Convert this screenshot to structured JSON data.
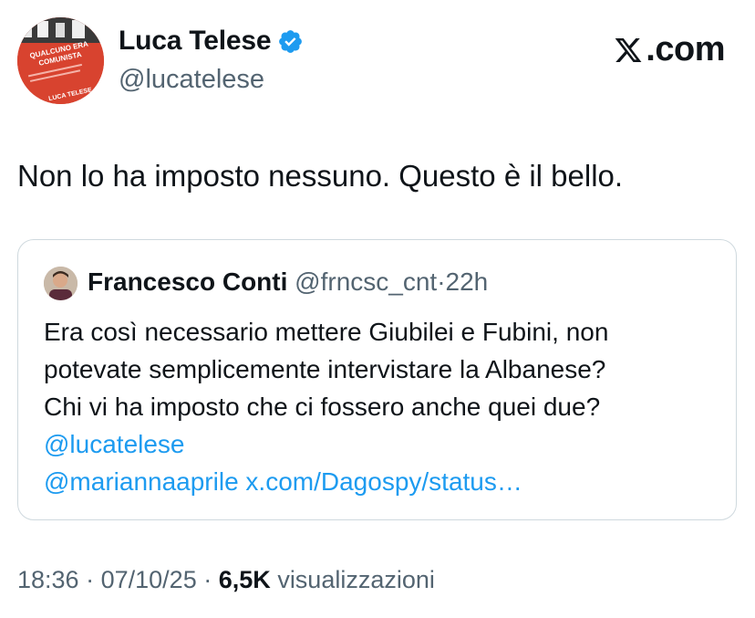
{
  "author": {
    "name": "Luca Telese",
    "handle": "@lucatelese",
    "avatar_lines": [
      "QUALCUNO ERA",
      "COMUNISTA",
      "LUCA TELESE"
    ]
  },
  "brand": {
    "text": ".com",
    "icon": "x-logo-icon"
  },
  "tweet": {
    "text": "Non lo ha imposto nessuno. Questo è il bello."
  },
  "quote": {
    "name": "Francesco Conti",
    "handle": "@frncsc_cnt",
    "separator": "·",
    "time": "22h",
    "lines": [
      "Era così necessario mettere Giubilei e Fubini, non",
      "potevate semplicemente intervistare la Albanese?",
      "Chi vi ha imposto che ci fossero anche quei due?"
    ],
    "mention_1": "@lucatelese",
    "mention_2": "@mariannaaprile",
    "link": "x.com/Dagospy/status…"
  },
  "footer": {
    "time": "18:36",
    "sep1": "·",
    "date": "07/10/25",
    "sep2": "·",
    "views_count": "6,5K",
    "views_label": "visualizzazioni"
  },
  "colors": {
    "link": "#1d9bf0",
    "verified": "#1d9bf0",
    "muted": "#536471"
  }
}
